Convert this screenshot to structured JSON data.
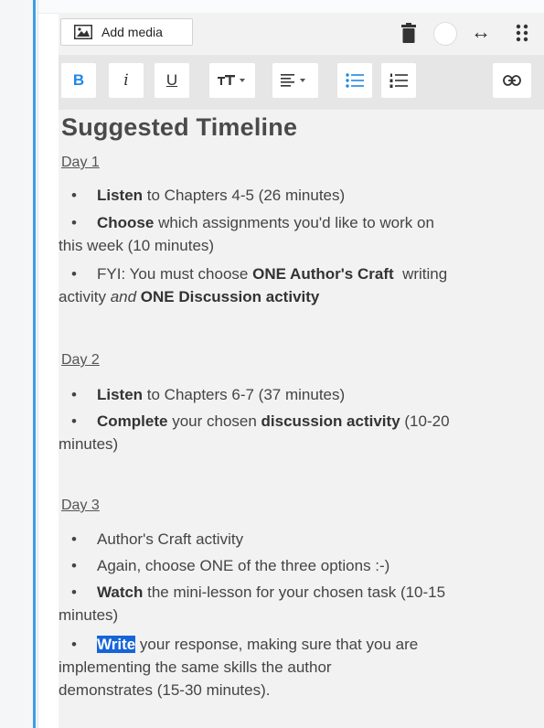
{
  "header": {
    "add_media_label": "Add media",
    "icons": [
      "image-icon",
      "trash-icon",
      "toggle-circle",
      "resize-horizontal-icon",
      "drag-handle-icon"
    ],
    "resize_glyph": "↔"
  },
  "toolbar": {
    "bold": "B",
    "italic": "i",
    "underline": "U",
    "icons": [
      "text-size-icon",
      "align-icon",
      "bullet-list-icon",
      "numbered-list-icon",
      "link-icon"
    ]
  },
  "content": {
    "title": "Suggested Timeline",
    "day1": {
      "label": "Day 1",
      "l1_bold": "Listen",
      "l1_rest": " to Chapters 4-5 (26 minutes)",
      "l2_bold": "Choose",
      "l2_rest_a": " which assignments you'd like to work on",
      "l2_rest_b": "this week (10 minutes)",
      "l3_a": "FYI: You must choose ",
      "l3_bold1": "ONE Author's Craft",
      "l3_b": "  writing",
      "l3_c": "activity ",
      "l3_ital": "and",
      "l3_d": " ",
      "l3_bold2": "ONE Discussion activity"
    },
    "day2": {
      "label": "Day 2",
      "l1_bold": "Listen",
      "l1_rest": " to Chapters 6-7 (37 minutes)",
      "l2_bold": "Complete",
      "l2_mid": " your chosen ",
      "l2_bold2": "discussion activity",
      "l2_rest": " (10-20",
      "l2_wrap": "minutes)"
    },
    "day3": {
      "label": "Day 3",
      "l1": "Author's Craft activity",
      "l2": "Again, choose ONE of the three options :-)",
      "l3_bold": "Watch",
      "l3_rest": " the mini-lesson for your chosen task (10-15",
      "l3_wrap": "minutes)",
      "l4_hl": "Write",
      "l4_rest": " your response, making sure that you are",
      "l4_wrap1": "implementing the same skills the author",
      "l4_wrap2": "demonstrates (15-30 minutes)."
    }
  },
  "colors": {
    "accent": "#3d9fe6",
    "toolbar_icon_active": "#1e88e5",
    "selection": "#1565d8"
  }
}
